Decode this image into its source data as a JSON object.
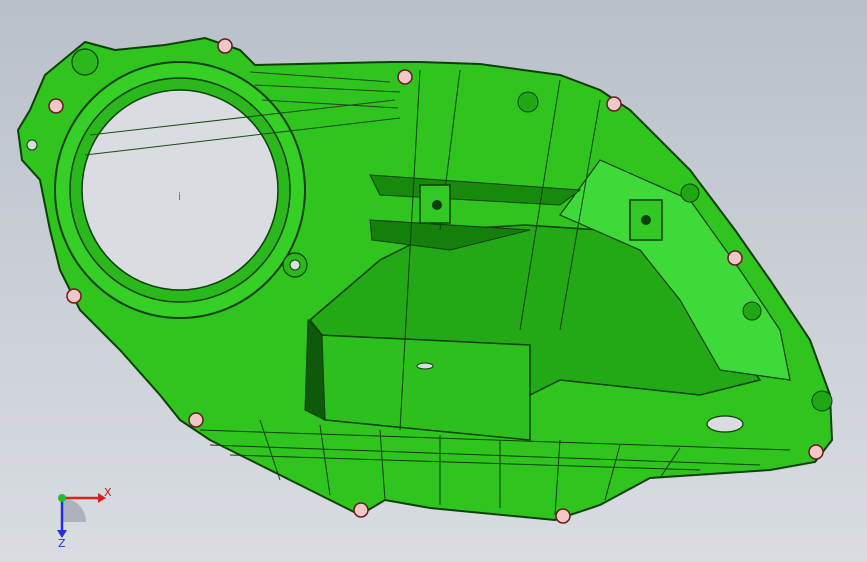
{
  "viewport": {
    "background_top": "#b9c0c9",
    "background_bottom": "#d9dde2",
    "center_marker": "i"
  },
  "part": {
    "body_color": "#2fc41e",
    "edge_color": "#0d3f07",
    "dark_face_color": "#1a8f10",
    "light_face_color": "#3fd93a",
    "bolt_color": "#f0c8c8"
  },
  "triad": {
    "x_label": "X",
    "z_label": "Z",
    "x_color": "#e02020",
    "z_color": "#2030e0",
    "y_color": "#20c020"
  }
}
